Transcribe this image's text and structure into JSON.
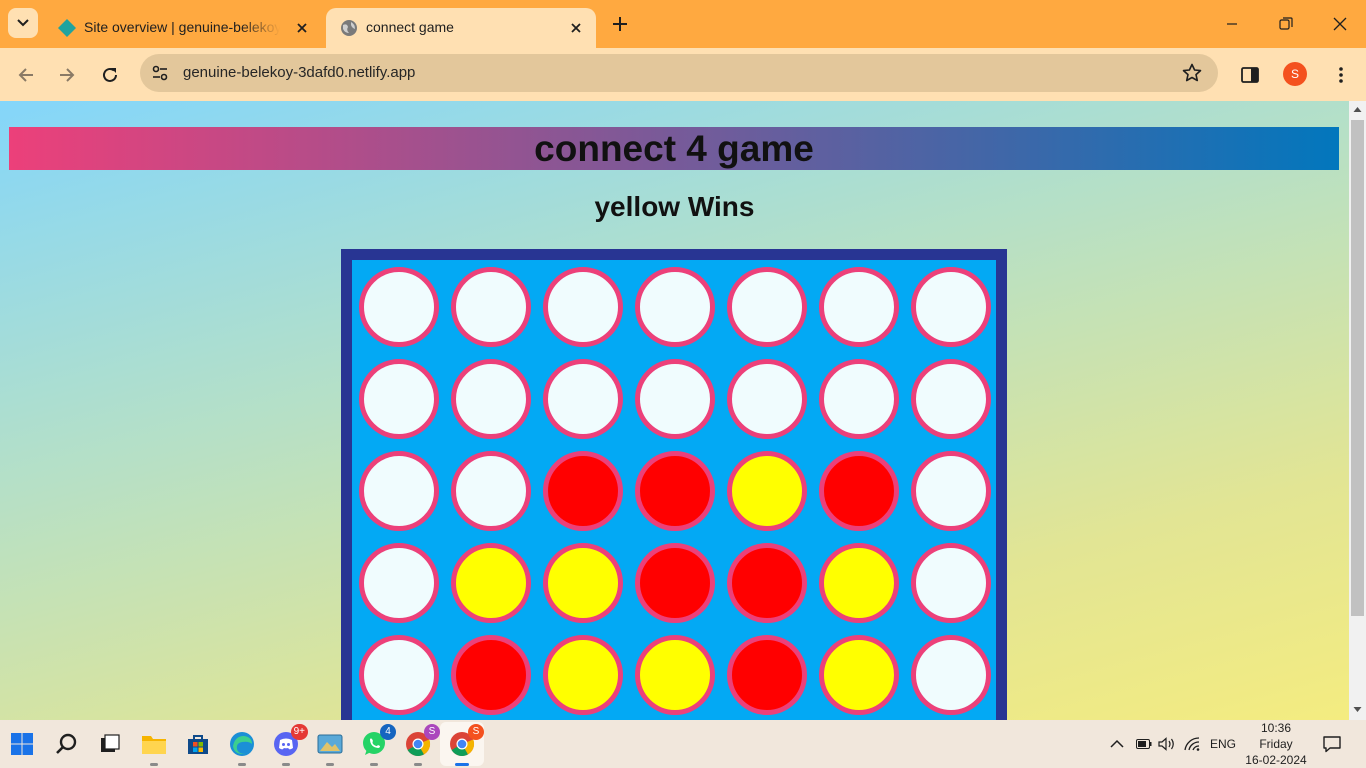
{
  "browser": {
    "tabs": [
      {
        "title": "Site overview | genuine-belekoy",
        "active": false,
        "icon": "netlify-diamond-icon"
      },
      {
        "title": "connect game",
        "active": true,
        "icon": "globe-icon"
      }
    ],
    "url": "genuine-belekoy-3dafd0.netlify.app",
    "profile_initial": "S"
  },
  "page": {
    "header_title": "connect 4 game",
    "status": "yellow Wins"
  },
  "board": {
    "rows_visible": 5,
    "cols": 7,
    "cells": [
      [
        "empty",
        "empty",
        "empty",
        "empty",
        "empty",
        "empty",
        "empty"
      ],
      [
        "empty",
        "empty",
        "empty",
        "empty",
        "empty",
        "empty",
        "empty"
      ],
      [
        "empty",
        "empty",
        "red",
        "red",
        "yellow",
        "red",
        "empty"
      ],
      [
        "empty",
        "yellow",
        "yellow",
        "red",
        "red",
        "yellow",
        "empty"
      ],
      [
        "empty",
        "red",
        "yellow",
        "yellow",
        "red",
        "yellow",
        "empty"
      ]
    ],
    "colors": {
      "empty": "#f0fcfe",
      "red": "#ff0000",
      "yellow": "#ffff00",
      "rim": "#ec407a",
      "board": "#03a9f4",
      "frame": "#283593"
    }
  },
  "taskbar": {
    "badges": {
      "discord": "9+",
      "whatsapp": "4",
      "chrome": "S",
      "chrome_active": "S"
    },
    "tray": {
      "language": "ENG"
    },
    "clock": {
      "time": "10:36",
      "day": "Friday",
      "date": "16-02-2024"
    }
  }
}
